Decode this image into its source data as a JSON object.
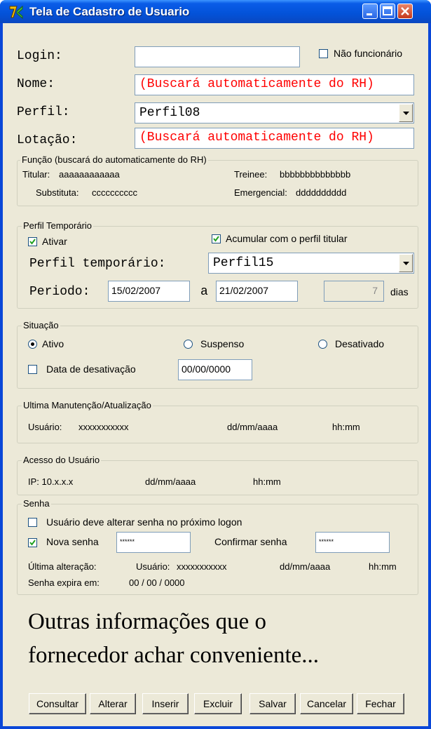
{
  "window": {
    "title": "Tela de Cadastro de Usuario"
  },
  "form": {
    "login_label": "Login:",
    "login_value": "",
    "nao_funcionario_label": "Não funcionário",
    "nao_funcionario_checked": false,
    "nome_label": "Nome:",
    "nome_value": "(Buscará automaticamente do RH)",
    "perfil_label": "Perfil:",
    "perfil_value": "Perfil08",
    "lotacao_label": "Lotação:",
    "lotacao_value": "(Buscará automaticamente do RH)"
  },
  "funcao": {
    "legend": "Função (buscará do automaticamente do RH)",
    "titular_label": "Titular:",
    "titular_value": "aaaaaaaaaaaa",
    "trainee_label": "Treinee:",
    "trainee_value": "bbbbbbbbbbbbbb",
    "substituta_label": "Substituta:",
    "substituta_value": "cccccccccc",
    "emergencial_label": "Emergencial:",
    "emergencial_value": "dddddddddd"
  },
  "perfil_temporario": {
    "legend": "Perfil Temporário",
    "ativar_label": "Ativar",
    "ativar_checked": true,
    "acumular_label": "Acumular com o perfil titular",
    "acumular_checked": true,
    "perfil_label": "Perfil temporário:",
    "perfil_value": "Perfil15",
    "periodo_label": "Periodo:",
    "date_from": "15/02/2007",
    "a_label": "a",
    "date_to": "21/02/2007",
    "dias_value": "7",
    "dias_label": "dias"
  },
  "situacao": {
    "legend": "Situação",
    "options": [
      "Ativo",
      "Suspenso",
      "Desativado"
    ],
    "selected": "Ativo",
    "data_desativacao_label": "Data de desativação",
    "data_desativacao_checked": false,
    "data_desativacao_value": "00/00/0000"
  },
  "manutencao": {
    "legend": "Ultima Manutenção/Atualização",
    "usuario_label": "Usuário:",
    "usuario_value": "xxxxxxxxxxx",
    "date": "dd/mm/aaaa",
    "time": "hh:mm"
  },
  "acesso": {
    "legend": "Acesso do Usuário",
    "ip_text": "IP: 10.x.x.x",
    "date": "dd/mm/aaaa",
    "time": "hh:mm"
  },
  "senha": {
    "legend": "Senha",
    "deve_alterar_label": "Usuário deve alterar senha no próximo logon",
    "deve_alterar_checked": false,
    "nova_label": "Nova senha",
    "nova_checked": true,
    "nova_value": "******",
    "confirmar_label": "Confirmar senha",
    "confirmar_value": "******",
    "ultima_label": "Última alteração:",
    "usuario_label": "Usuário:",
    "usuario_value": "xxxxxxxxxxx",
    "date": "dd/mm/aaaa",
    "time": "hh:mm",
    "expira_label": "Senha expira em:",
    "expira_value": "00 / 00 / 0000"
  },
  "note": {
    "line1": "Outras informações que o",
    "line2": "fornecedor achar conveniente..."
  },
  "buttons": {
    "consultar": "Consultar",
    "alterar": "Alterar",
    "inserir": "Inserir",
    "excluir": "Excluir",
    "salvar": "Salvar",
    "cancelar": "Cancelar",
    "fechar": "Fechar"
  },
  "colors": {
    "titlebar": "#0A5CE8",
    "face": "#ECE9D8",
    "hint_text": "#FF0000"
  }
}
